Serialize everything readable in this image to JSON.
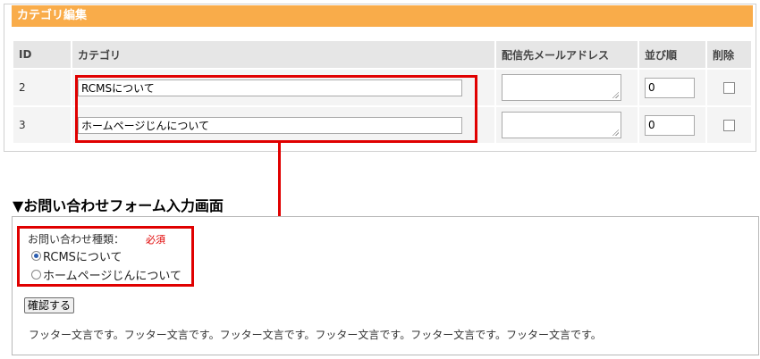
{
  "category_edit": {
    "header_title": "カテゴリ編集",
    "columns": [
      "ID",
      "カテゴリ",
      "配信先メールアドレス",
      "並び順",
      "削除"
    ],
    "rows": [
      {
        "id": "2",
        "category": "RCMSについて",
        "email": "",
        "order": "0",
        "delete": false
      },
      {
        "id": "3",
        "category": "ホームページじんについて",
        "email": "",
        "order": "0",
        "delete": false
      }
    ]
  },
  "form_section": {
    "title": "▼お問い合わせフォーム入力画面",
    "inquiry_label": "お問い合わせ種類：",
    "required_label": "必須",
    "options": [
      {
        "label": "RCMSについて",
        "selected": true
      },
      {
        "label": "ホームページじんについて",
        "selected": false
      }
    ],
    "confirm_button": "確認する",
    "footer_text": "フッター文言です。フッター文言です。フッター文言です。フッター文言です。フッター文言です。フッター文言です。"
  },
  "colors": {
    "header_orange": "#f9ac4a",
    "highlight_red": "#e00000"
  }
}
